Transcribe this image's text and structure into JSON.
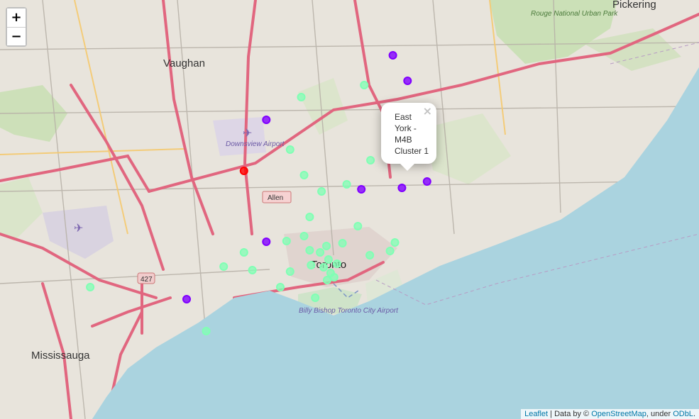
{
  "controls": {
    "zoom_in": "+",
    "zoom_out": "−"
  },
  "popup": {
    "text": "East York - M4B Cluster 1",
    "close": "×"
  },
  "attribution": {
    "leaflet": "Leaflet",
    "sep1": " | Data by © ",
    "osm": "OpenStreetMap",
    "sep2": ", under ",
    "odbl": "ODbL",
    "end": "."
  },
  "places": {
    "vaughan": "Vaughan",
    "pickering": "Pickering",
    "mississauga": "Mississauga",
    "toronto": "Toronto",
    "downsview": "Downsview Airport",
    "billy_bishop": "Billy Bishop Toronto City Airport",
    "rouge": "Rouge National Urban Park",
    "allen": "Allen"
  },
  "colors": {
    "cluster0": "#ff0000",
    "cluster1": "#8000ff",
    "cluster2": "#80ffb4",
    "water": "#aad3df"
  },
  "markers": [
    {
      "cluster": 1,
      "lon": 0.562,
      "lat": 0.078
    },
    {
      "cluster": 1,
      "lon": 0.583,
      "lat": 0.114
    },
    {
      "cluster": 1,
      "lon": 0.381,
      "lat": 0.169
    },
    {
      "cluster": 1,
      "lon": 0.575,
      "lat": 0.265
    },
    {
      "cluster": 1,
      "lon": 0.611,
      "lat": 0.256
    },
    {
      "cluster": 1,
      "lon": 0.517,
      "lat": 0.267
    },
    {
      "cluster": 1,
      "lon": 0.381,
      "lat": 0.341
    },
    {
      "cluster": 1,
      "lon": 0.267,
      "lat": 0.422
    },
    {
      "cluster": 0,
      "lon": 0.349,
      "lat": 0.241
    },
    {
      "cluster": 2,
      "lon": 0.431,
      "lat": 0.137
    },
    {
      "cluster": 2,
      "lon": 0.521,
      "lat": 0.12
    },
    {
      "cluster": 2,
      "lon": 0.415,
      "lat": 0.211
    },
    {
      "cluster": 2,
      "lon": 0.435,
      "lat": 0.247
    },
    {
      "cluster": 2,
      "lon": 0.46,
      "lat": 0.27
    },
    {
      "cluster": 2,
      "lon": 0.496,
      "lat": 0.26
    },
    {
      "cluster": 2,
      "lon": 0.53,
      "lat": 0.226
    },
    {
      "cluster": 2,
      "lon": 0.443,
      "lat": 0.306
    },
    {
      "cluster": 2,
      "lon": 0.512,
      "lat": 0.319
    },
    {
      "cluster": 2,
      "lon": 0.435,
      "lat": 0.333
    },
    {
      "cluster": 2,
      "lon": 0.41,
      "lat": 0.34
    },
    {
      "cluster": 2,
      "lon": 0.49,
      "lat": 0.343
    },
    {
      "cluster": 2,
      "lon": 0.443,
      "lat": 0.353
    },
    {
      "cluster": 2,
      "lon": 0.467,
      "lat": 0.347
    },
    {
      "cluster": 2,
      "lon": 0.458,
      "lat": 0.356
    },
    {
      "cluster": 2,
      "lon": 0.565,
      "lat": 0.342
    },
    {
      "cluster": 2,
      "lon": 0.558,
      "lat": 0.354
    },
    {
      "cluster": 2,
      "lon": 0.529,
      "lat": 0.36
    },
    {
      "cluster": 2,
      "lon": 0.349,
      "lat": 0.356
    },
    {
      "cluster": 2,
      "lon": 0.47,
      "lat": 0.366
    },
    {
      "cluster": 2,
      "lon": 0.482,
      "lat": 0.372
    },
    {
      "cluster": 2,
      "lon": 0.463,
      "lat": 0.377
    },
    {
      "cluster": 2,
      "lon": 0.473,
      "lat": 0.385
    },
    {
      "cluster": 2,
      "lon": 0.478,
      "lat": 0.391
    },
    {
      "cluster": 2,
      "lon": 0.468,
      "lat": 0.395
    },
    {
      "cluster": 2,
      "lon": 0.445,
      "lat": 0.374
    },
    {
      "cluster": 2,
      "lon": 0.32,
      "lat": 0.376
    },
    {
      "cluster": 2,
      "lon": 0.361,
      "lat": 0.381
    },
    {
      "cluster": 2,
      "lon": 0.415,
      "lat": 0.383
    },
    {
      "cluster": 2,
      "lon": 0.401,
      "lat": 0.405
    },
    {
      "cluster": 2,
      "lon": 0.129,
      "lat": 0.405
    },
    {
      "cluster": 2,
      "lon": 0.295,
      "lat": 0.467
    },
    {
      "cluster": 2,
      "lon": 0.451,
      "lat": 0.42
    }
  ]
}
